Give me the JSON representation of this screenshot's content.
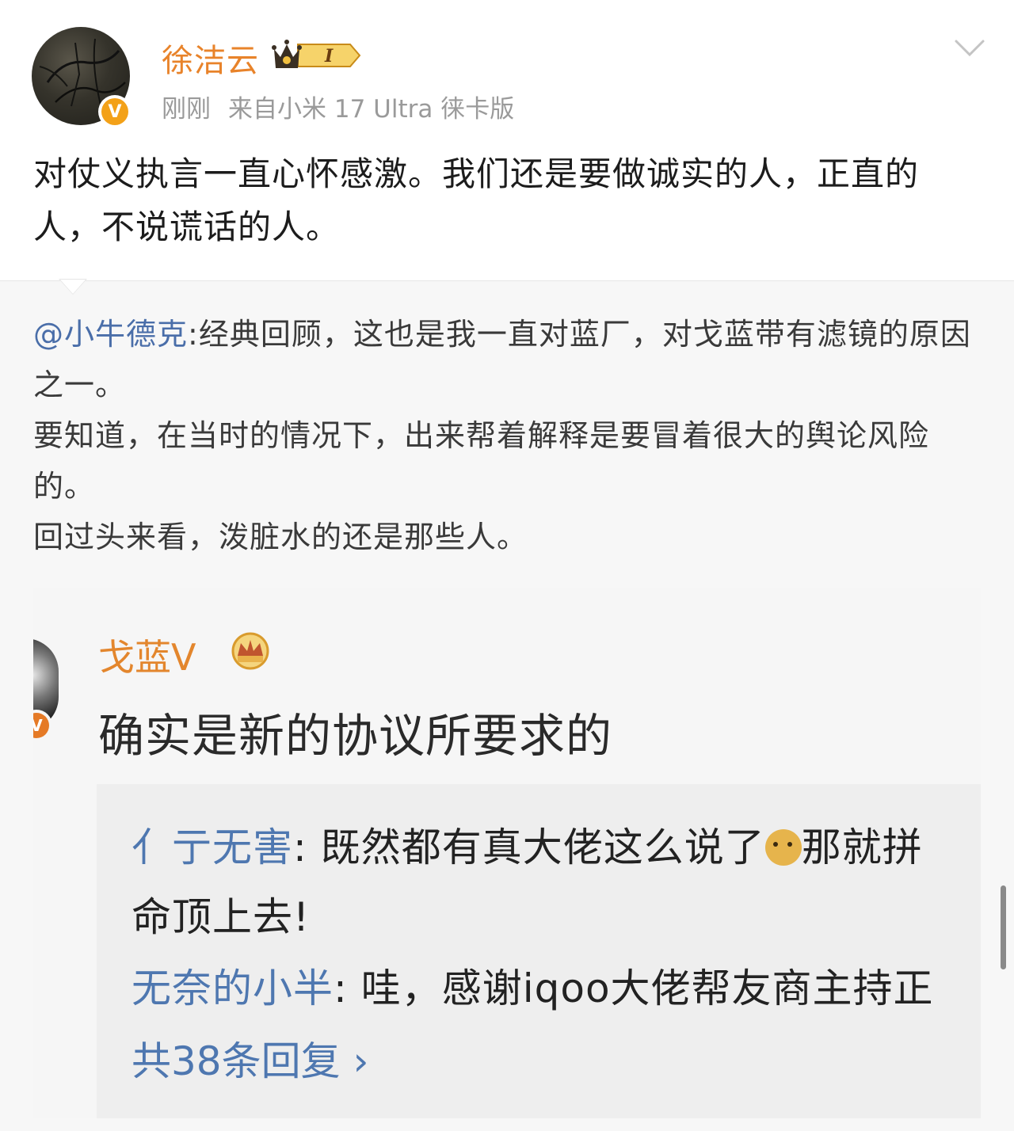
{
  "post": {
    "username": "徐洁云",
    "member_level": "I",
    "time": "刚刚",
    "source": "来自小米 17 Ultra 徕卡版",
    "text": "对仗义执言一直心怀感激。我们还是要做诚实的人，正直的人，不说谎话的人。"
  },
  "repost": {
    "mention": "@小牛德克",
    "line1": ":经典回顾，这也是我一直对蓝厂，对戈蓝带有滤镜的原因之一。",
    "line2": "要知道，在当时的情况下，出来帮着解释是要冒着很大的舆论风险的。",
    "line3": "回过头来看，泼脏水的还是那些人。"
  },
  "screenshot": {
    "name": "戈蓝V",
    "comment": "确实是新的协议所要求的",
    "replies": [
      {
        "user": "亻亍无害",
        "text_a": ": 既然都有真大佬这么说了",
        "text_b": "那就拼",
        "text_c": "命顶上去!"
      },
      {
        "user": "无奈的小半",
        "text_a": ": 哇，感谢iqoo大佬帮友商主持正"
      }
    ],
    "more": "共38条回复 ›"
  },
  "icons": {
    "verified": "verified-v-badge-icon",
    "member": "crown-member-icon",
    "expand": "chevron-down-icon",
    "emoji": "doge-emoji-icon"
  },
  "colors": {
    "username": "#e8832a",
    "mention": "#4a6ea9",
    "verified": "#f3a118",
    "reply_user": "#4e77b0"
  }
}
